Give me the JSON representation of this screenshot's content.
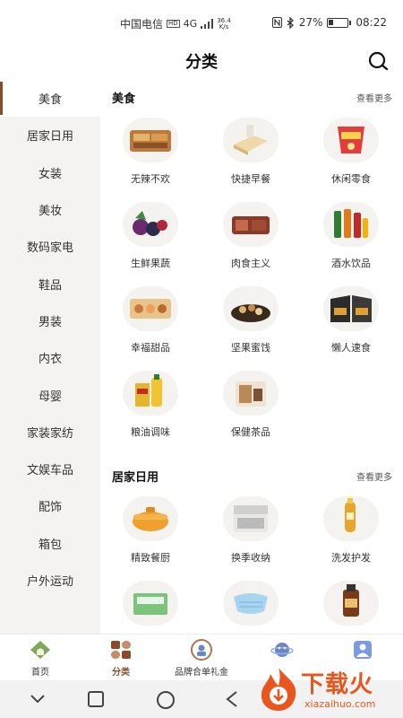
{
  "status_bar": {
    "carrier": "中国电信",
    "hd": "HD",
    "network": "4G",
    "speed_value": "36.4",
    "speed_unit": "K/s",
    "battery": "27%",
    "time": "08:22"
  },
  "header": {
    "title": "分类",
    "search_icon": "search-icon"
  },
  "sidebar": {
    "items": [
      {
        "label": "美食"
      },
      {
        "label": "居家日用"
      },
      {
        "label": "女装"
      },
      {
        "label": "美妆"
      },
      {
        "label": "数码家电"
      },
      {
        "label": "鞋品"
      },
      {
        "label": "男装"
      },
      {
        "label": "内衣"
      },
      {
        "label": "母婴"
      },
      {
        "label": "家装家纺"
      },
      {
        "label": "文娱车品"
      },
      {
        "label": "配饰"
      },
      {
        "label": "箱包"
      },
      {
        "label": "户外运动"
      }
    ],
    "active_index": 0
  },
  "sections": [
    {
      "title": "美食",
      "more": "查看更多",
      "items": [
        {
          "label": "无辣不欢"
        },
        {
          "label": "快捷早餐"
        },
        {
          "label": "休闲零食"
        },
        {
          "label": "生鲜果蔬"
        },
        {
          "label": "肉食主义"
        },
        {
          "label": "酒水饮品"
        },
        {
          "label": "幸福甜品"
        },
        {
          "label": "坚果蜜饯"
        },
        {
          "label": "懒人速食"
        },
        {
          "label": "粮油调味"
        },
        {
          "label": "保健茶品"
        }
      ]
    },
    {
      "title": "居家日用",
      "more": "查看更多",
      "items": [
        {
          "label": "精致餐厨"
        },
        {
          "label": "换季收纳"
        },
        {
          "label": "洗发护发"
        },
        {
          "label": ""
        },
        {
          "label": ""
        },
        {
          "label": ""
        }
      ]
    }
  ],
  "bottom_nav": {
    "items": [
      {
        "label": "首页",
        "icon": "home-icon"
      },
      {
        "label": "分类",
        "icon": "category-icon"
      },
      {
        "label": "品牌合单礼金",
        "icon": "brand-icon"
      },
      {
        "label": "",
        "icon": "planet-icon"
      },
      {
        "label": "",
        "icon": "profile-icon"
      }
    ],
    "active_index": 1
  },
  "watermark": {
    "text": "下载火",
    "sub": "xiazaihuo.com"
  },
  "colors": {
    "accent": "#8a4b2c",
    "sidebar_bg": "#f4f3f1",
    "watermark": "#e8561e"
  }
}
